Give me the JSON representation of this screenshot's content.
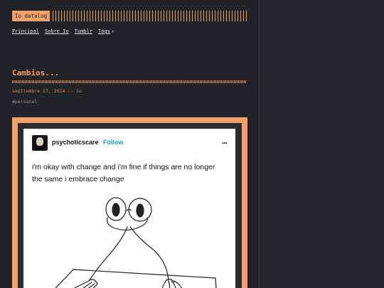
{
  "blog": {
    "logo": "Io datalog",
    "nav": [
      "Principal",
      "Sobre Io",
      "Tumblr",
      "Tags"
    ],
    "tags_caret": "▾"
  },
  "post": {
    "title": "Cambios...",
    "meta": "septiembre 27, 2024 :: Io",
    "tag": "#personal"
  },
  "reblog": {
    "username": "psychoticscare",
    "follow_label": "Follow",
    "more_icon": "...",
    "text": "i'm okay with change and i'm fine if things are no longer the same i embrace change",
    "avatar_caption": "icon"
  },
  "colors": {
    "accent": "#f4a06b",
    "background": "#222327",
    "follow": "#1ea0c9"
  }
}
